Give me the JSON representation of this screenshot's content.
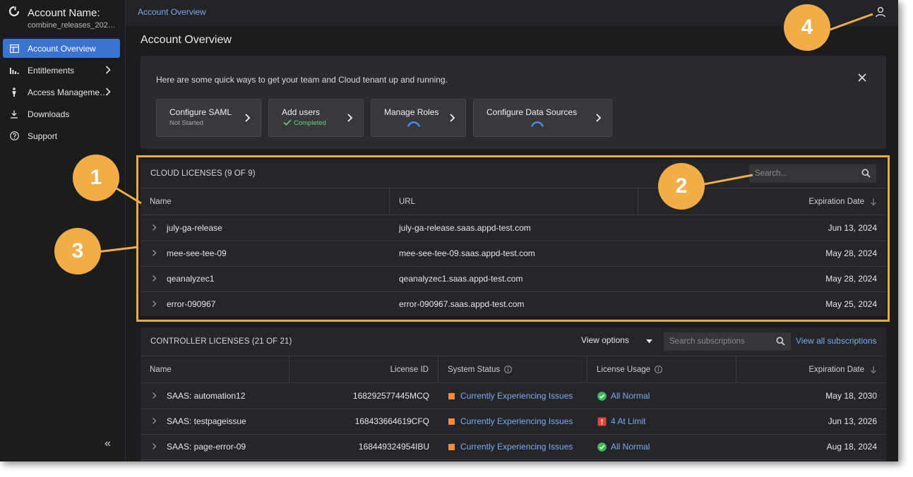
{
  "sidebar": {
    "account_title": "Account Name:",
    "account_sub": "combine_releases_202…",
    "items": [
      {
        "label": "Account Overview",
        "icon": "dashboard-icon",
        "active": true
      },
      {
        "label": "Entitlements",
        "icon": "bar-chart-icon",
        "has_submenu": true
      },
      {
        "label": "Access Manageme…",
        "icon": "person-icon",
        "has_submenu": true
      },
      {
        "label": "Downloads",
        "icon": "download-icon"
      },
      {
        "label": "Support",
        "icon": "help-circle-icon"
      }
    ],
    "collapse_label": "«"
  },
  "topbar": {
    "breadcrumb": "Account Overview",
    "user_icon": "user-icon"
  },
  "page_title": "Account Overview",
  "quick_start": {
    "text": "Here are some quick ways to get your team and Cloud tenant up and running.",
    "cards": [
      {
        "title": "Configure SAML",
        "subtitle": "Not Started",
        "state": "not-started"
      },
      {
        "title": "Add users",
        "subtitle": "Completed",
        "state": "completed"
      },
      {
        "title": "Manage Roles",
        "subtitle": "",
        "state": "loading"
      },
      {
        "title": "Configure Data Sources",
        "subtitle": "",
        "state": "loading"
      }
    ]
  },
  "cloud_licenses": {
    "title": "CLOUD LICENSES (9 OF 9)",
    "search_placeholder": "Search...",
    "columns": [
      "Name",
      "URL",
      "Expiration Date"
    ],
    "rows": [
      {
        "name": "july-ga-release",
        "url": "july-ga-release.saas.appd-test.com",
        "expiration": "Jun 13, 2024"
      },
      {
        "name": "mee-see-tee-09",
        "url": "mee-see-tee-09.saas.appd-test.com",
        "expiration": "May 28, 2024"
      },
      {
        "name": "qeanalyzec1",
        "url": "qeanalyzec1.saas.appd-test.com",
        "expiration": "May 28, 2024"
      },
      {
        "name": "error-090967",
        "url": "error-090967.saas.appd-test.com",
        "expiration": "May 25, 2024"
      }
    ]
  },
  "controller_licenses": {
    "title": "CONTROLLER LICENSES (21 OF 21)",
    "view_options": "View options",
    "search_placeholder": "Search subscriptions",
    "view_all": "View all subscriptions",
    "columns": [
      "Name",
      "License ID",
      "System Status",
      "License Usage",
      "Expiration Date"
    ],
    "rows": [
      {
        "name": "SAAS: automation12",
        "license_id": "168292577445MCQ",
        "status": "Currently Experiencing Issues",
        "usage": "All Normal",
        "usage_state": "ok",
        "expiration": "May 18, 2030"
      },
      {
        "name": "SAAS: testpageissue",
        "license_id": "168433664619CFQ",
        "status": "Currently Experiencing Issues",
        "usage": "4 At Limit",
        "usage_state": "alert",
        "expiration": "Jun 13, 2026"
      },
      {
        "name": "SAAS: page-error-09",
        "license_id": "168449324954IBU",
        "status": "Currently Experiencing Issues",
        "usage": "All Normal",
        "usage_state": "ok",
        "expiration": "Aug 18, 2024"
      }
    ]
  },
  "callouts": [
    "1",
    "2",
    "3",
    "4"
  ],
  "colors": {
    "accent": "#3a73d1",
    "link": "#7fa9ef",
    "callout": "#f0ad48",
    "status_orange": "#f08a3c",
    "ok_green": "#3fbf5a",
    "alert_red": "#e0443a"
  }
}
